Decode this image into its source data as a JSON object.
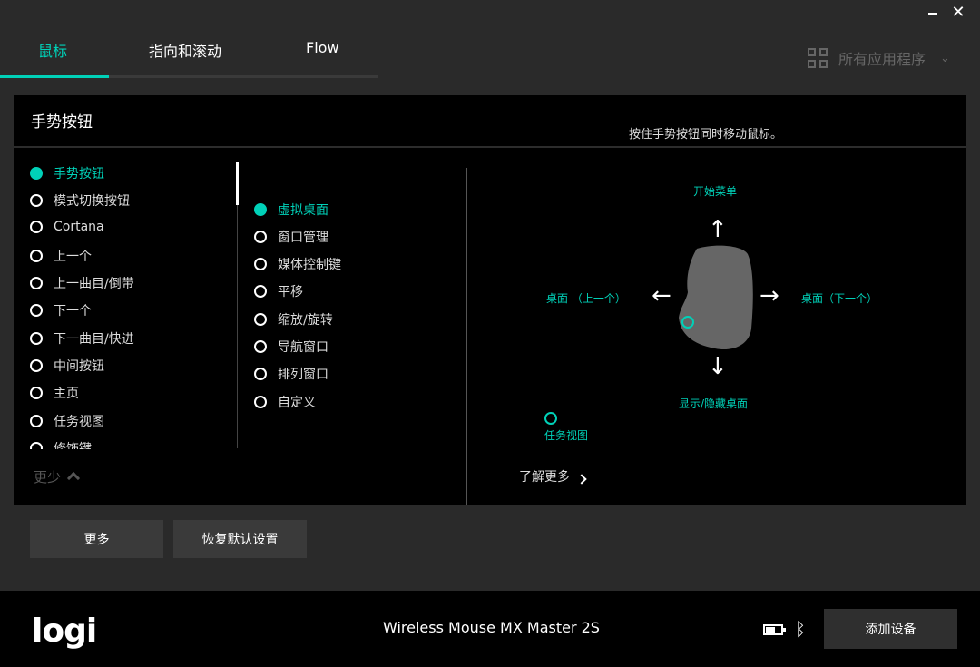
{
  "window": {
    "minimize": "—",
    "close": "✕"
  },
  "tabs": [
    {
      "label": "鼠标"
    },
    {
      "label": "指向和滚动"
    },
    {
      "label": "Flow"
    }
  ],
  "apps_selector": {
    "label": "所有应用程序",
    "icon": "grid-icon"
  },
  "panel": {
    "title": "手势按钮",
    "hint": "按住手势按钮同时移动鼠标。",
    "buttons_list": [
      {
        "label": "手势按钮",
        "active": true
      },
      {
        "label": "模式切换按钮"
      },
      {
        "label": "Cortana"
      },
      {
        "label": "上一个"
      },
      {
        "label": "上一曲目/倒带"
      },
      {
        "label": "下一个"
      },
      {
        "label": "下一曲目/快进"
      },
      {
        "label": "中间按钮"
      },
      {
        "label": "主页"
      },
      {
        "label": "任务视图"
      },
      {
        "label": "修饰键"
      }
    ],
    "gesture_options": [
      {
        "label": "虚拟桌面",
        "active": true
      },
      {
        "label": "窗口管理"
      },
      {
        "label": "媒体控制键"
      },
      {
        "label": "平移"
      },
      {
        "label": "缩放/旋转"
      },
      {
        "label": "导航窗口"
      },
      {
        "label": "排列窗口"
      },
      {
        "label": "自定义"
      }
    ],
    "collapse_label": "更少",
    "gestures": {
      "up": "开始菜单",
      "left": "桌面 （上一个）",
      "right": "桌面（下一个）",
      "down": "显示/隐藏桌面",
      "click": "任务视图"
    },
    "learn_more": "了解更多"
  },
  "actions": {
    "more": "更多",
    "reset": "恢复默认设置"
  },
  "footer": {
    "logo": "logi",
    "device_name": "Wireless Mouse MX Master 2S",
    "battery_icon": "battery-icon",
    "bluetooth_icon": "bluetooth-icon",
    "add_device": "添加设备"
  },
  "colors": {
    "accent": "#00d1b8",
    "panel": "#000000",
    "background": "#2a2a2a"
  }
}
